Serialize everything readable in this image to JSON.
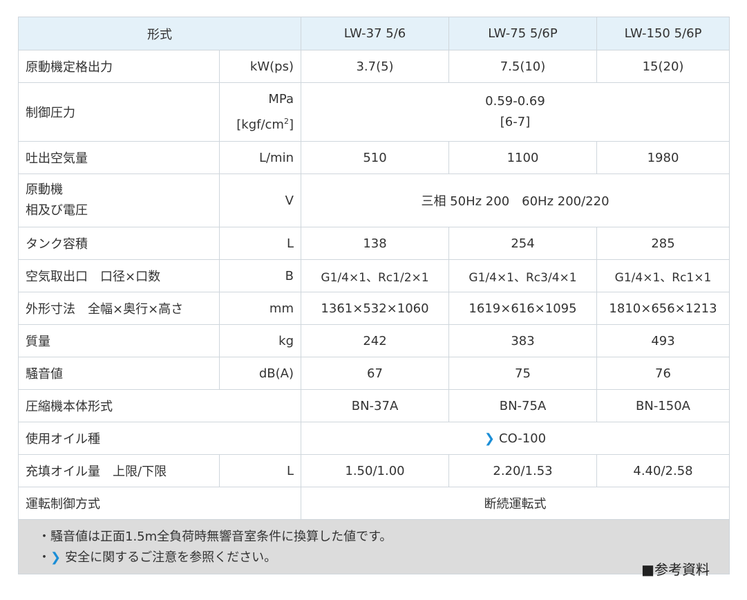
{
  "header": {
    "model_label": "形式",
    "models": [
      "LW-37 5/6",
      "LW-75 5/6P",
      "LW-150 5/6P"
    ]
  },
  "rows": {
    "power": {
      "label": "原動機定格出力",
      "unit": "kW(ps)",
      "values": [
        "3.7(5)",
        "7.5(10)",
        "15(20)"
      ]
    },
    "pressure": {
      "label": "制御圧力",
      "unit_line1": "MPa",
      "unit_line2_base": "[kgf/cm",
      "unit_line2_sup": "2",
      "unit_line2_end": "]",
      "value_line1": "0.59-0.69",
      "value_line2": "[6-7]"
    },
    "air_flow": {
      "label": "吐出空気量",
      "unit": "L/min",
      "values": [
        "510",
        "1100",
        "1980"
      ]
    },
    "motor": {
      "label_line1": "原動機",
      "label_line2": "相及び電圧",
      "unit": "V",
      "value": "三相 50Hz 200　60Hz 200/220"
    },
    "tank": {
      "label": "タンク容積",
      "unit": "L",
      "values": [
        "138",
        "254",
        "285"
      ]
    },
    "outlet": {
      "label": "空気取出口　口径×口数",
      "unit": "B",
      "values": [
        "G1/4×1、Rc1/2×1",
        "G1/4×1、Rc3/4×1",
        "G1/4×1、Rc1×1"
      ]
    },
    "dimensions": {
      "label": "外形寸法　全幅×奥行×高さ",
      "unit": "mm",
      "values": [
        "1361×532×1060",
        "1619×616×1095",
        "1810×656×1213"
      ]
    },
    "mass": {
      "label": "質量",
      "unit": "kg",
      "values": [
        "242",
        "383",
        "493"
      ]
    },
    "noise": {
      "label": "騒音値",
      "unit": "dB(A)",
      "values": [
        "67",
        "75",
        "76"
      ]
    },
    "compressor": {
      "label": "圧縮機本体形式",
      "values": [
        "BN-37A",
        "BN-75A",
        "BN-150A"
      ]
    },
    "oil_type": {
      "label": "使用オイル種",
      "value": "CO-100",
      "icon": "chevron-right-icon"
    },
    "oil_amount": {
      "label": "充填オイル量　上限/下限",
      "unit": "L",
      "values": [
        "1.50/1.00",
        "2.20/1.53",
        "4.40/2.58"
      ]
    },
    "control": {
      "label": "運転制御方式",
      "value": "断続運転式"
    }
  },
  "notes": {
    "note1": "・騒音値は正面1.5m全負荷時無響音室条件に換算した値です。",
    "note2_prefix": "・",
    "note2_link": "安全に関するご注意を参照ください。",
    "reference": "■参考資料"
  },
  "colors": {
    "header_bg": "#e4f1f9",
    "note_bg": "#dcdcdc",
    "border": "#cfd6dc",
    "link_accent": "#1b8ed6"
  }
}
